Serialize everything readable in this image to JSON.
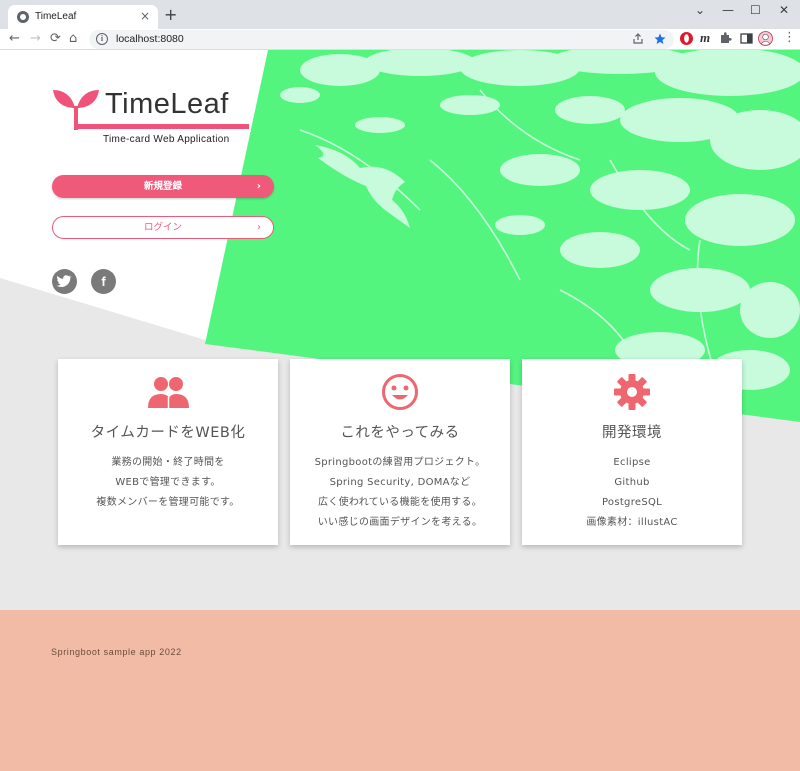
{
  "browser": {
    "tab_title": "TimeLeaf",
    "tab_close": "×",
    "new_tab": "+",
    "url": "localhost:8080",
    "window_controls": {
      "minimize": "—",
      "maximize": "☐",
      "close": "✕"
    },
    "nav": {
      "back": "←",
      "forward": "→",
      "reload": "⟳",
      "home": "⌂"
    },
    "info": "i"
  },
  "hero": {
    "logo_text": "TimeLeaf",
    "logo_subtitle": "Time-card Web Application",
    "primary_button": "新規登録",
    "secondary_button": "ログイン",
    "arrow": "›",
    "social": {
      "twitter_icon": "twitter-icon",
      "facebook": "f"
    },
    "colors": {
      "green": "#54f57f",
      "accent": "#ef5a7a"
    }
  },
  "cards": [
    {
      "icon": "users-icon",
      "title": "タイムカードをWEB化",
      "lines": [
        "業務の開始・終了時間を",
        "WEBで管理できます。",
        "複数メンバーを管理可能です。"
      ]
    },
    {
      "icon": "smile-icon",
      "title": "これをやってみる",
      "lines": [
        "Springbootの練習用プロジェクト。",
        "Spring Security, DOMAなど",
        "広く使われている機能を使用する。",
        "いい感じの画面デザインを考える。"
      ]
    },
    {
      "icon": "gear-icon",
      "title": "開発環境",
      "lines": [
        "Eclipse",
        "Github",
        "PostgreSQL",
        "画像素材：illustAC"
      ]
    }
  ],
  "footer": {
    "text": "Springboot sample app 2022"
  }
}
